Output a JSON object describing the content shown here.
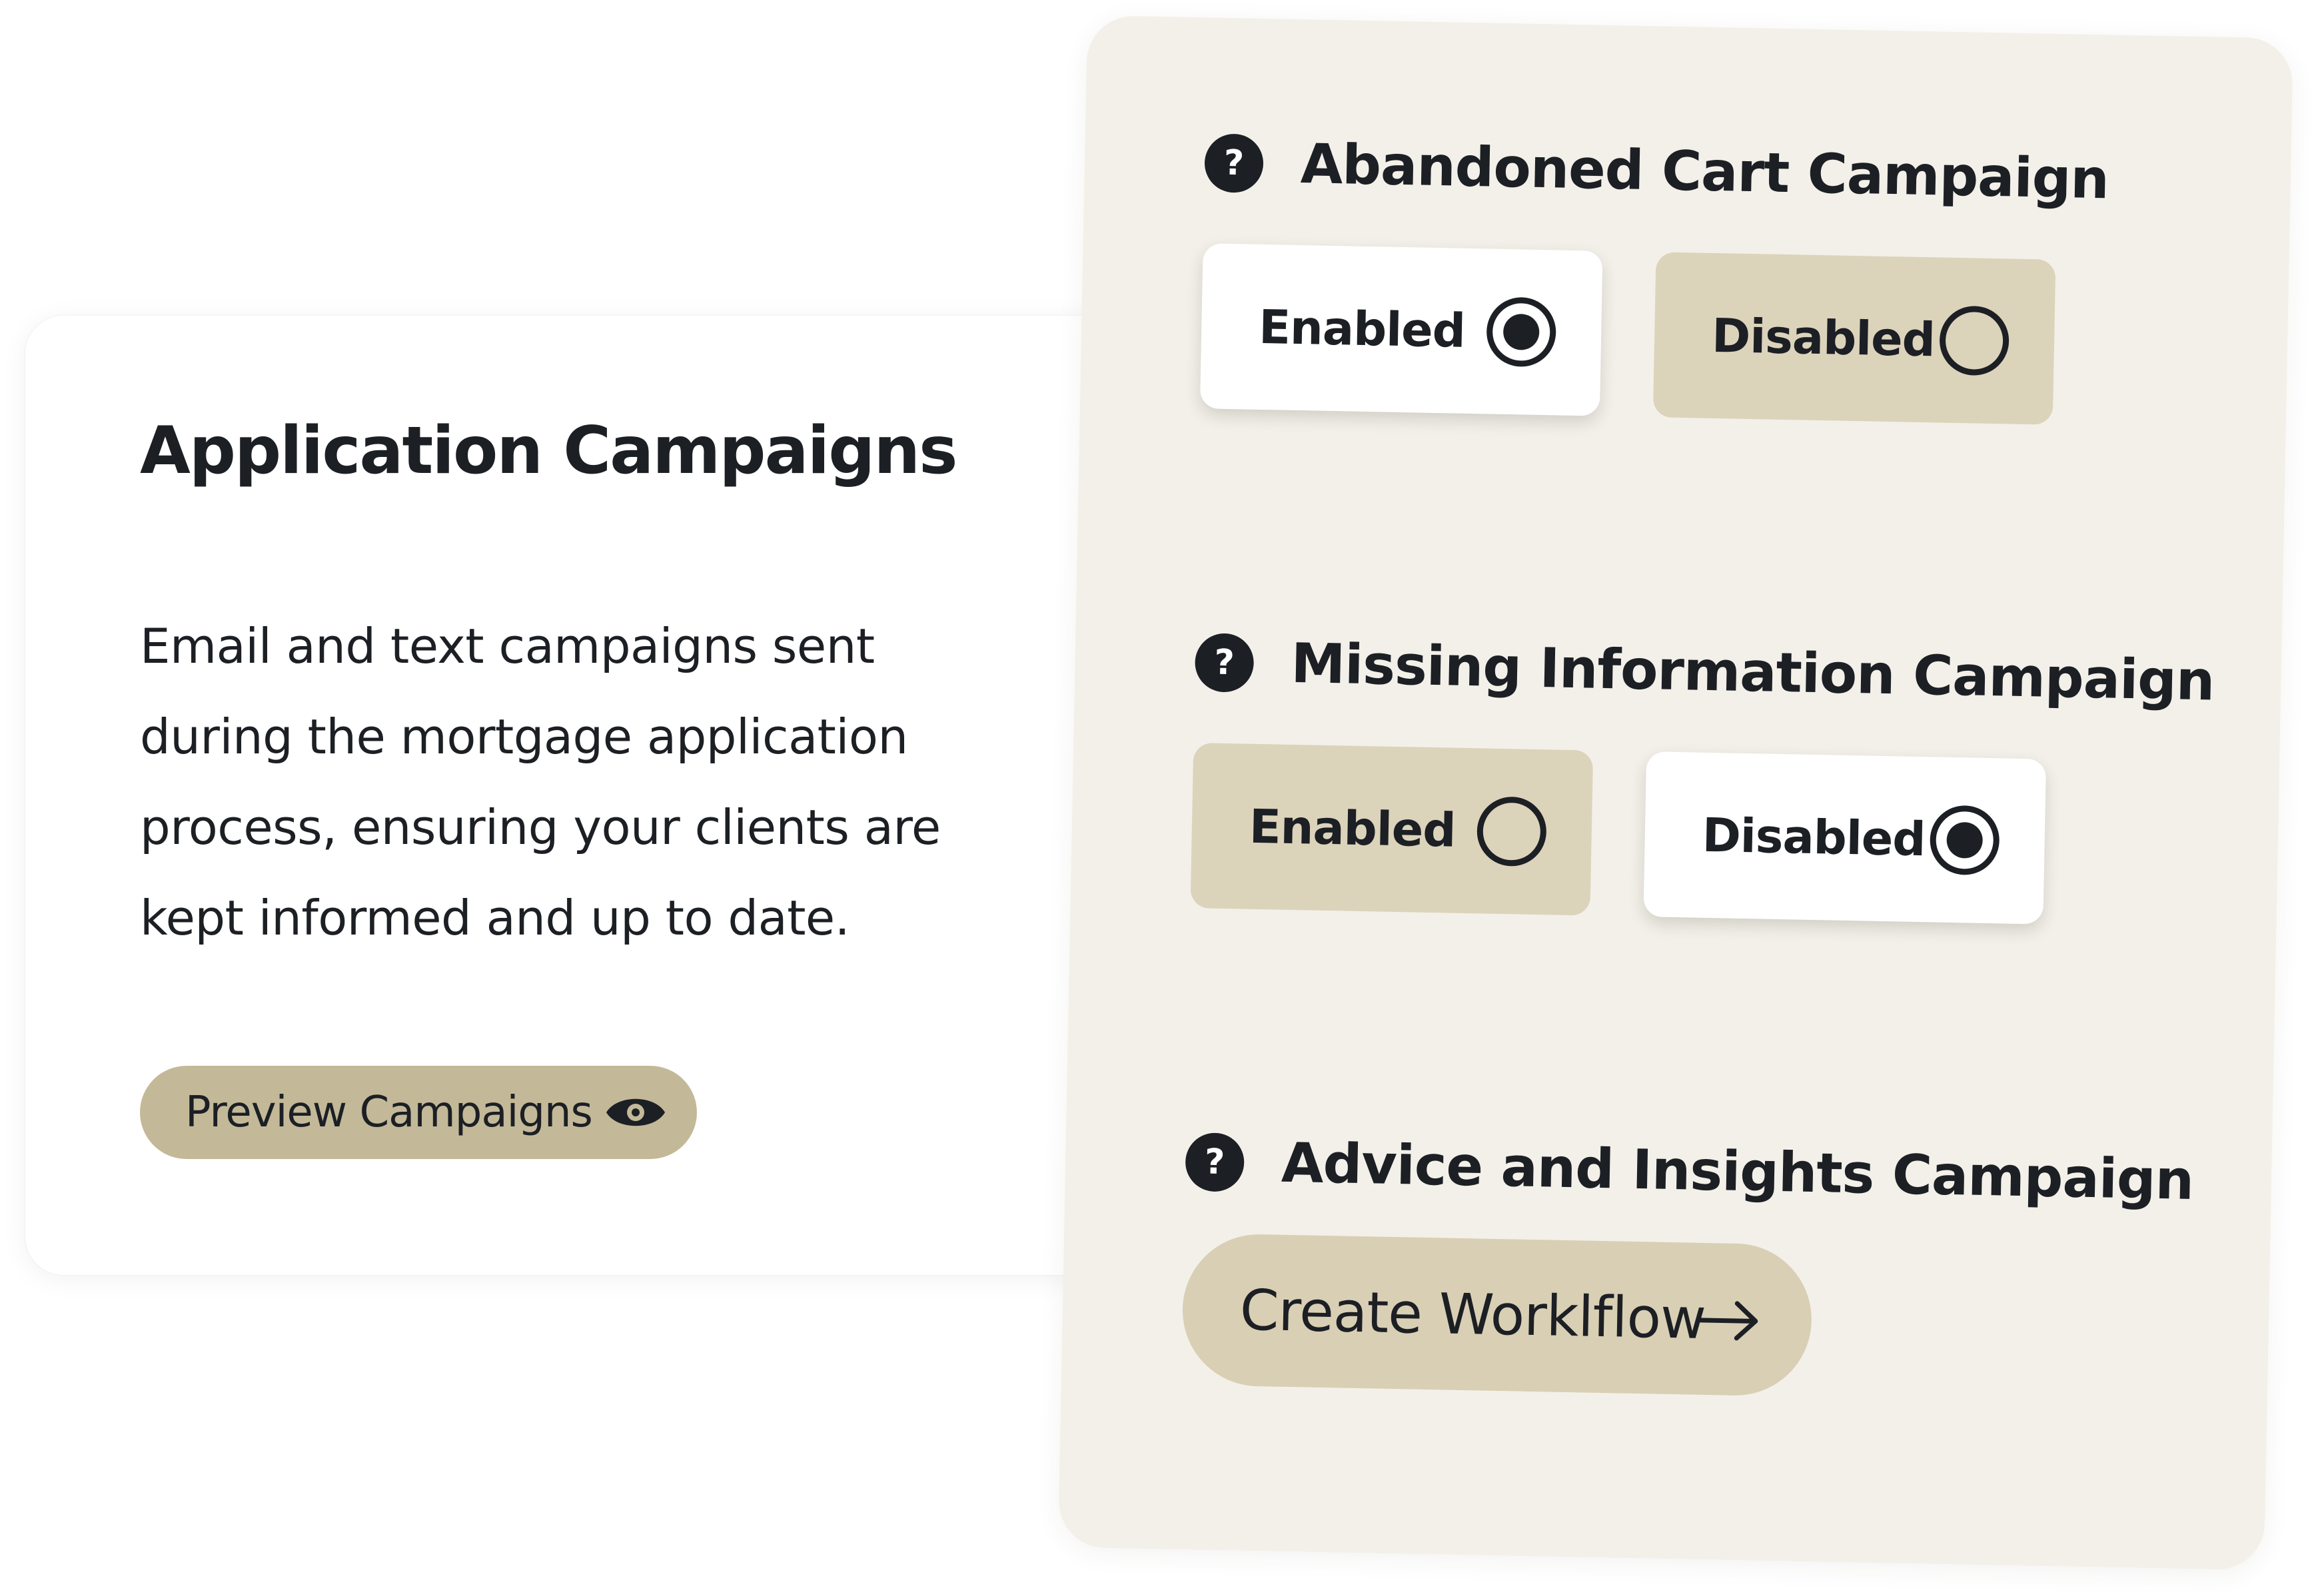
{
  "left_card": {
    "title": "Application Campaigns",
    "description": "Email and text campaigns sent during the mortgage application process, ensuring your clients are kept informed and up to date.",
    "preview_button": {
      "label": "Preview Campaigns",
      "icon": "eye-icon"
    }
  },
  "right_panel": {
    "help_icon_glyph": "?",
    "sections": [
      {
        "title": "Abandoned Cart Campaign",
        "options": [
          {
            "label": "Enabled",
            "selected": true
          },
          {
            "label": "Disabled",
            "selected": false
          }
        ]
      },
      {
        "title": "Missing Information Campaign",
        "options": [
          {
            "label": "Enabled",
            "selected": false
          },
          {
            "label": "Disabled",
            "selected": true
          }
        ]
      },
      {
        "title": "Advice and Insights Campaign",
        "action_button": {
          "label": "Create Worklflow",
          "icon": "arrow-right-icon"
        }
      }
    ]
  },
  "colors": {
    "text": "#1c1f24",
    "panel_background": "#f3f0e9",
    "preview_button": "#c3b998",
    "unselected_option": "#dcd3bb",
    "create_button": "#d9cfb4"
  }
}
